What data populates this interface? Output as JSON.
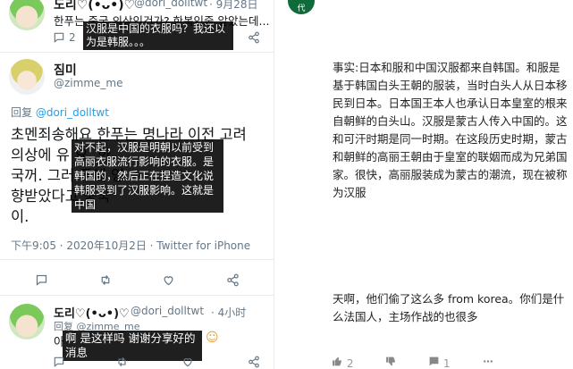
{
  "left": {
    "post1": {
      "name": "도리♡(•ᴗ•)♡",
      "handle": "@dori_dolltwt",
      "date": "· 9月28日",
      "korean": "한푸는 중국 의상인건가? 한복인줄 알았는데...",
      "caption": "汉服是中国的衣服吗？我还以为是韩服。。。",
      "reply_count": "2"
    },
    "post2": {
      "name": "짐미",
      "handle": "@zimme_me",
      "reply_to_prefix": "回复",
      "reply_to_mention": "@dori_dolltwt",
      "korean_lines": [
        "초멘죄송해요 한푸는 명나라 이전 고려",
        "의상에 유                       요. 한",
        "국꺼. 그러                     푸에 영",
        "향받았다고                       중국",
        "이."
      ],
      "caption": "对不起，汉服是明朝以前受到高丽衣服流行影响的衣服。是韩国的，然后正在捏造文化说韩服受到了汉服影响。这就是中国",
      "timestamp": "下午9:05 · 2020年10月2日 · Twitter for iPhone"
    },
    "post3": {
      "name": "도리♡(•ᴗ•)♡",
      "handle": "@dori_dolltwt",
      "date": "· 4小时",
      "reply_to": "回复 @zimme_me",
      "korean": "아",
      "caption": "啊 是这样吗 谢谢分享好的消息",
      "emoji": "☺"
    }
  },
  "right": {
    "avatar_label": "代",
    "top_text": "事实:日本和服和中国汉服都来自韩国。和服是基于韩国白头王朝的服装，当时白头人从日本移民到日本。日本国王本人也承认日本皇室的根来自朝鲜的白头山。汉服是蒙古人传入中国的。这和可汗时期是同一时期。在这段历史时期，蒙古和朝鲜的高丽王朝由于皇室的联姻而成为兄弟国家。很快，高丽服装成为蒙古的潮流，现在被称为汉服",
    "bottom_text": "天啊，他们偷了这么多 from korea。你们是什么法国人，主场作战的也很多",
    "like_count": "2",
    "comment_count": "1"
  }
}
